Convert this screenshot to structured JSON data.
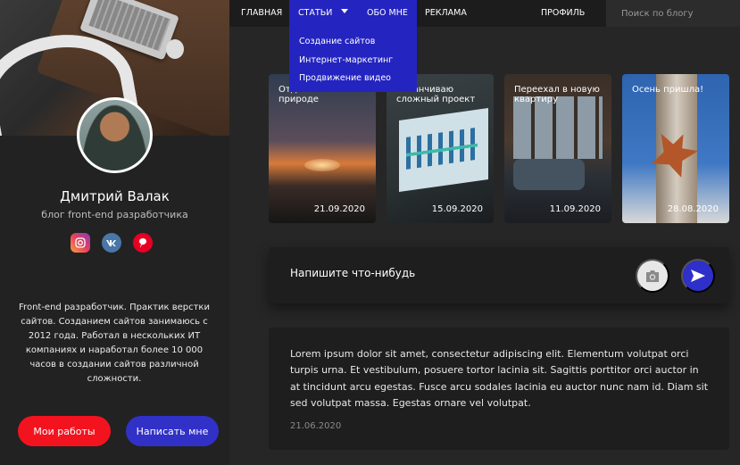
{
  "nav": {
    "home": "ГЛАВНАЯ",
    "articles": "СТАТЬИ",
    "about": "ОБО МНЕ",
    "ads": "РЕКЛАМА",
    "profile": "ПРОФИЛЬ",
    "search_placeholder": "Поиск по блогу"
  },
  "dropdown": {
    "items": [
      "Создание сайтов",
      "Интернет-маркетинг",
      "Продвижение видео"
    ]
  },
  "profile": {
    "name": "Дмитрий Валак",
    "subtitle": "блог front-end разработчика",
    "about": "Front-end разработчик. Практик верстки сайтов.  Созданием сайтов занимаюсь с 2012 года. Работал в нескольких ИТ компаниях и наработал более 10 000 часов в создании сайтов различной сложности.",
    "socials": [
      "instagram-icon",
      "vk-icon",
      "pinterest-icon"
    ],
    "btn_works": "Мои работы",
    "btn_write": "Написать мне"
  },
  "cards": [
    {
      "title": "Отдыхаю на природе",
      "date": "21.09.2020"
    },
    {
      "title": "Заканчиваю сложный проект",
      "date": "15.09.2020"
    },
    {
      "title": "Переехал в новую квартиру",
      "date": "11.09.2020"
    },
    {
      "title": "Осень пришла!",
      "date": "28.08.2020"
    }
  ],
  "composer": {
    "placeholder": "Напишите что-нибудь"
  },
  "post": {
    "text": "Lorem ipsum dolor sit amet, consectetur adipiscing elit. Elementum volutpat orci turpis urna. Et vestibulum, posuere tortor lacinia sit. Sagittis porttitor orci auctor in at tincidunt arcu egestas. Fusce arcu sodales lacinia eu auctor nunc nam id. Diam sit sed volutpat massa. Egestas ornare vel volutpat.",
    "date": "21.06.2020"
  },
  "colors": {
    "accent_blue": "#2424c0",
    "accent_red": "#f3131f",
    "background": "#262626"
  }
}
